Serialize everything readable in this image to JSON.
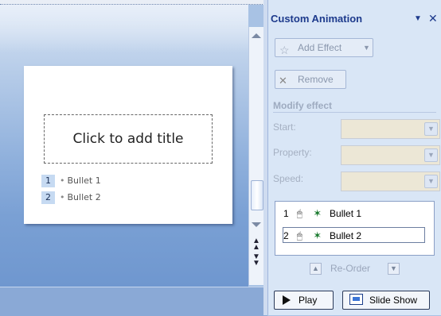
{
  "slide": {
    "title_placeholder": "Click to add title",
    "bullets": [
      {
        "num": "1",
        "text": "Bullet 1"
      },
      {
        "num": "2",
        "text": "Bullet 2"
      }
    ]
  },
  "pane": {
    "title": "Custom Animation",
    "menu_glyph": "▼",
    "close_glyph": "✕",
    "add_effect": "Add Effect",
    "add_effect_icon": "add-effect-icon",
    "remove": "Remove",
    "remove_icon": "remove-icon",
    "modify_heading": "Modify effect",
    "labels": {
      "start": "Start:",
      "property": "Property:",
      "speed": "Speed:"
    },
    "animation_list": [
      {
        "order": "1",
        "trigger_icon": "mouse-click-icon",
        "effect_icon": "entrance-star-icon",
        "text": "Bullet 1",
        "selected": false
      },
      {
        "order": "2",
        "trigger_icon": "mouse-click-icon",
        "effect_icon": "entrance-star-icon",
        "text": "Bullet 2",
        "selected": true
      }
    ],
    "reorder": "Re-Order",
    "play": "Play",
    "slide_show": "Slide Show"
  },
  "colors": {
    "pane_background": "#d9e6f6",
    "pane_title": "#1d3a8c",
    "slide_area": "#8fb0dc",
    "effect_star": "#1a7a2e"
  }
}
